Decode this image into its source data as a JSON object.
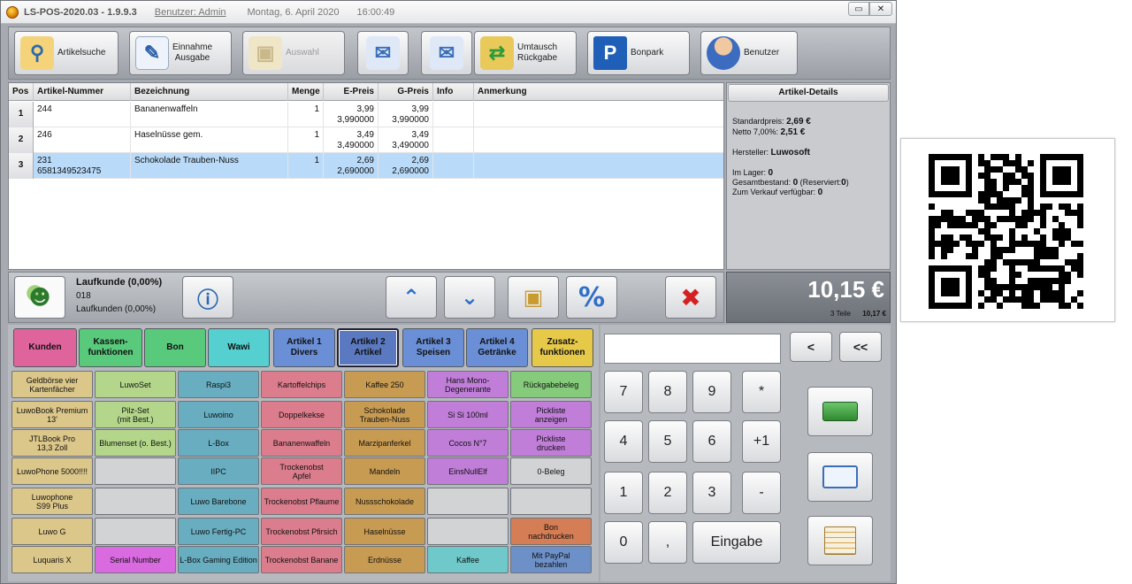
{
  "titlebar": {
    "app_title": "LS-POS-2020.03 - 1.9.9.3",
    "user": "Benutzer: Admin",
    "date": "Montag, 6. April 2020",
    "time": "16:00:49",
    "minimize": "▭",
    "close": "✕"
  },
  "toolbar": [
    {
      "label": "Artikelsuche",
      "icon": "magnifier-icon"
    },
    {
      "label": "Einnahme\nAusgabe",
      "icon": "notepad-pen-icon"
    },
    {
      "label": "Auswahl",
      "icon": "boxes-icon"
    },
    {
      "label": "",
      "icon": "envelope-in-icon"
    },
    {
      "label": "",
      "icon": "envelope-out-icon"
    },
    {
      "label": "Umtausch\nRückgabe",
      "icon": "exchange-icon"
    },
    {
      "label": "Bonpark",
      "icon": "parking-icon"
    },
    {
      "label": "Benutzer",
      "icon": "user-icon"
    }
  ],
  "items": {
    "columns": [
      "Pos",
      "Artikel-Nummer",
      "Bezeichnung",
      "Menge",
      "E-Preis",
      "G-Preis",
      "Info",
      "Anmerkung"
    ],
    "rows": [
      {
        "pos": "1",
        "nr": "244",
        "nr2": "",
        "name": "Bananenwaffeln",
        "qty": "1",
        "ep": "3,99",
        "ep2": "3,990000",
        "gp": "3,99",
        "gp2": "3,990000"
      },
      {
        "pos": "2",
        "nr": "246",
        "nr2": "",
        "name": "Haselnüsse gem.",
        "qty": "1",
        "ep": "3,49",
        "ep2": "3,490000",
        "gp": "3,49",
        "gp2": "3,490000"
      },
      {
        "pos": "3",
        "nr": "231",
        "nr2": "6581349523475",
        "name": "Schokolade Trauben-Nuss",
        "qty": "1",
        "ep": "2,69",
        "ep2": "2,690000",
        "gp": "2,69",
        "gp2": "2,690000"
      }
    ]
  },
  "details": {
    "title": "Artikel-Details",
    "std_label": "Standardpreis:",
    "std_value": "2,69 €",
    "net_label": "Netto 7,00%:",
    "net_value": "2,51 €",
    "mfr_label": "Hersteller:",
    "mfr_value": "Luwosoft",
    "stock_label": "Im Lager:",
    "stock_value": "0",
    "total_label": "Gesamtbestand:",
    "total_value": "0",
    "res_label": "(Reserviert:",
    "res_value": "0",
    "res_close": ")",
    "avail_label": "Zum Verkauf verfügbar:",
    "avail_value": "0"
  },
  "customer": {
    "name": "Laufkunde (0,00%)",
    "number": "018",
    "group": "Laufkunden (0,00%)"
  },
  "totals": {
    "amount": "10,15 €",
    "count": "3 Teile",
    "small": "10,17 €"
  },
  "categories": [
    {
      "label": "Kunden",
      "color": "#e0649c"
    },
    {
      "label": "Kassen-\nfunktionen",
      "color": "#59c97c"
    },
    {
      "label": "Bon",
      "color": "#59c97c"
    },
    {
      "label": "Wawi",
      "color": "#55cfd0"
    },
    {
      "label": "Artikel 1\nDivers",
      "color": "#6a8fd6"
    },
    {
      "label": "Artikel 2\nArtikel",
      "color": "#5a79c0"
    },
    {
      "label": "Artikel 3\nSpeisen",
      "color": "#6a8fd6"
    },
    {
      "label": "Artikel 4\nGetränke",
      "color": "#6a8fd6"
    },
    {
      "label": "Zusatz-\nfunktionen",
      "color": "#e7c94a"
    }
  ],
  "grid": [
    [
      {
        "t": "Geldbörse vier\nKartenfächer",
        "c": "tan"
      },
      {
        "t": "LuwoBook Premium\n13'",
        "c": "tan"
      },
      {
        "t": "JTLBook Pro\n13,3 Zoll",
        "c": "tan"
      },
      {
        "t": "LuwoPhone 5000!!!!",
        "c": "tan"
      },
      {
        "t": "Luwophone\nS99 Plus",
        "c": "tan"
      },
      {
        "t": "Luwo G",
        "c": "tan"
      },
      {
        "t": "Luquaris X",
        "c": "tan"
      }
    ],
    [
      {
        "t": "LuwoSet",
        "c": "green"
      },
      {
        "t": "Pilz-Set\n(mit Best.)",
        "c": "green"
      },
      {
        "t": "Blumenset (o. Best.)",
        "c": "green"
      },
      {
        "t": "",
        "c": "grey"
      },
      {
        "t": "",
        "c": "grey"
      },
      {
        "t": "",
        "c": "grey"
      },
      {
        "t": "Serial Number",
        "c": "magenta"
      }
    ],
    [
      {
        "t": "Raspi3",
        "c": "teal"
      },
      {
        "t": "Luwoino",
        "c": "teal"
      },
      {
        "t": "L-Box",
        "c": "teal"
      },
      {
        "t": "IIPC",
        "c": "teal"
      },
      {
        "t": "Luwo Barebone",
        "c": "teal"
      },
      {
        "t": "Luwo Fertig-PC",
        "c": "teal"
      },
      {
        "t": "L-Box Gaming Edition",
        "c": "teal"
      }
    ],
    [
      {
        "t": "Kartoffelchips",
        "c": "pink"
      },
      {
        "t": "Doppelkekse",
        "c": "pink"
      },
      {
        "t": "Bananenwaffeln",
        "c": "pink"
      },
      {
        "t": "Trockenobst\nApfel",
        "c": "pink"
      },
      {
        "t": "Trockenobst Pflaume",
        "c": "pink"
      },
      {
        "t": "Trockenobst Pfirsich",
        "c": "pink"
      },
      {
        "t": "Trockenobst Banane",
        "c": "pink"
      }
    ],
    [
      {
        "t": "Kaffee 250",
        "c": "brown"
      },
      {
        "t": "Schokolade\nTrauben-Nuss",
        "c": "brown"
      },
      {
        "t": "Marzipanferkel",
        "c": "brown"
      },
      {
        "t": "Mandeln",
        "c": "brown"
      },
      {
        "t": "Nussschokolade",
        "c": "brown"
      },
      {
        "t": "Haselnüsse",
        "c": "brown"
      },
      {
        "t": "Erdnüsse",
        "c": "brown"
      }
    ],
    [
      {
        "t": "Hans Mono-\nDegenerante",
        "c": "purple"
      },
      {
        "t": "Si Si 100ml",
        "c": "purple"
      },
      {
        "t": "Cocos N°7",
        "c": "purple"
      },
      {
        "t": "EinsNullElf",
        "c": "purple"
      },
      {
        "t": "",
        "c": "grey"
      },
      {
        "t": "",
        "c": "grey"
      },
      {
        "t": "Kaffee",
        "c": "cyan"
      }
    ],
    [
      {
        "t": "Rückgabebeleg",
        "c": "ltgreen"
      },
      {
        "t": "Pickliste\nanzeigen",
        "c": "purple"
      },
      {
        "t": "Pickliste\ndrucken",
        "c": "purple"
      },
      {
        "t": "0-Beleg",
        "c": "grey"
      },
      {
        "t": "",
        "c": "grey"
      },
      {
        "t": "Bon\nnachdrucken",
        "c": "orange"
      },
      {
        "t": "Mit PayPal\nbezahlen",
        "c": "blue"
      }
    ]
  ],
  "numpad": {
    "back": "<",
    "back_all": "<<",
    "keys": [
      "7",
      "8",
      "9",
      "*",
      "4",
      "5",
      "6",
      "+1",
      "1",
      "2",
      "3",
      "-",
      "0",
      ","
    ],
    "enter": "Eingabe"
  }
}
